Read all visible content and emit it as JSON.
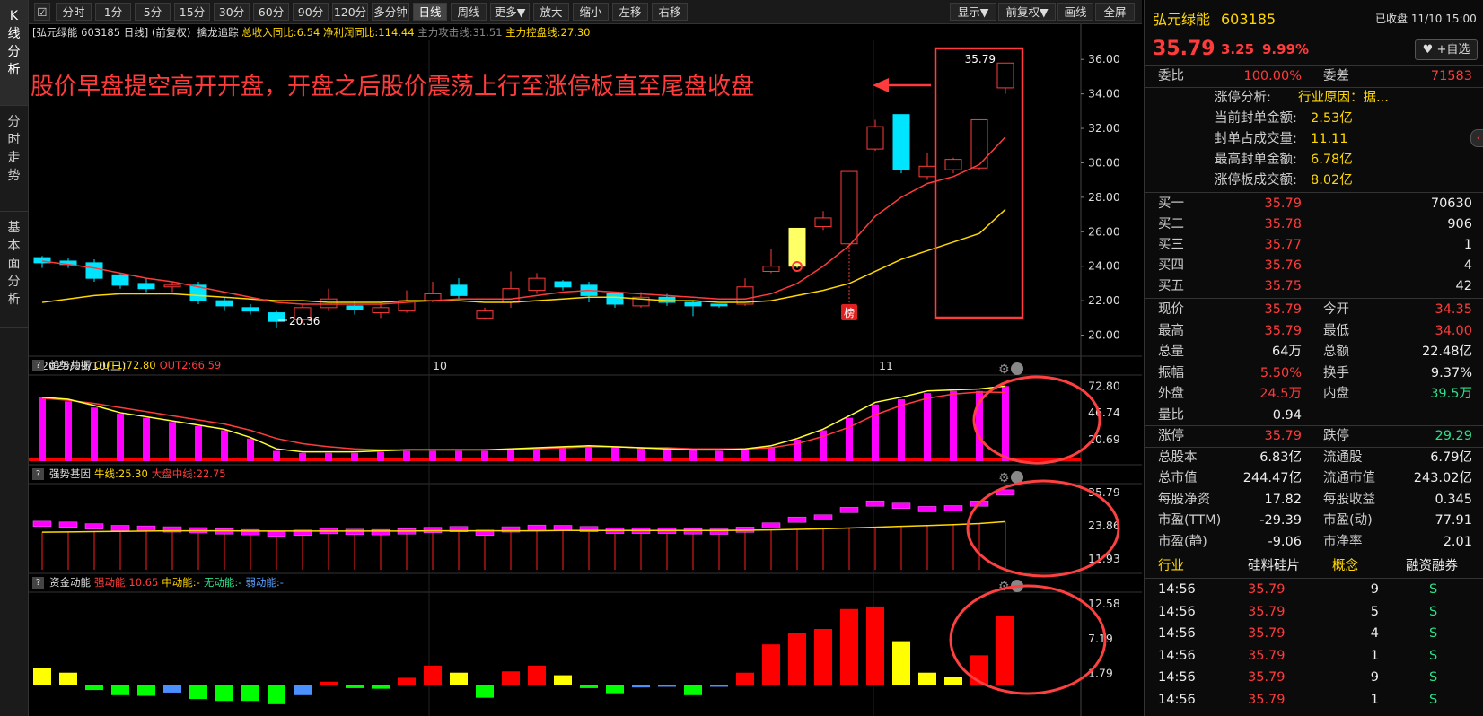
{
  "left_tabs": [
    "K线分析",
    "分时走势",
    "基本面分析"
  ],
  "toolbar": {
    "left": [
      "分时",
      "1分",
      "5分",
      "15分",
      "30分",
      "60分",
      "90分",
      "120分",
      "多分钟",
      "日线",
      "周线",
      "更多▼",
      "放大",
      "缩小",
      "左移",
      "右移"
    ],
    "active": "日线",
    "right": [
      "显示▼",
      "前复权▼",
      "画线",
      "全屏"
    ]
  },
  "main_header": {
    "name": "[弘元绿能 603185 日线]",
    "adj": "(前复权)",
    "indicator": "擒龙追踪",
    "item1": "总收入同比:6.54",
    "item2": "净利润同比:114.44",
    "item3": "主力攻击线:31.51",
    "item4": "主力控盘线:27.30"
  },
  "annotation_text": "股价早盘提空高开开盘，开盘之后股价震荡上行至涨停板直至尾盘收盘",
  "price_axis": [
    "36.00",
    "34.00",
    "32.00",
    "30.00",
    "28.00",
    "26.00",
    "24.00",
    "22.00",
    "20.00"
  ],
  "low_marker": "20.36",
  "high_marker": "35.79",
  "bang_label": "榜",
  "date_axis": {
    "start": "2025/09/10(三)",
    "m10": "10",
    "m11": "11"
  },
  "panels": {
    "trend": {
      "name": "趋势共振",
      "out1": "OUT1:72.80",
      "out2": "OUT2:66.59",
      "axis": [
        "72.80",
        "46.74",
        "20.69"
      ]
    },
    "strong": {
      "name": "强势基因",
      "bull": "牛线:25.30",
      "mid": "大盘中线:22.75",
      "axis": [
        "35.79",
        "23.86",
        "11.93"
      ]
    },
    "fund": {
      "name": "资金动能",
      "strong": "强动能:10.65",
      "mid": "中动能:-",
      "none": "无动能:-",
      "weak": "弱动能:-",
      "axis": [
        "12.58",
        "7.19",
        "1.79"
      ]
    }
  },
  "chart_data": {
    "type": "candlestick",
    "candles": [
      [
        24.5,
        24.2,
        24.6,
        23.9
      ],
      [
        24.3,
        24.1,
        24.5,
        23.9
      ],
      [
        24.2,
        23.3,
        24.4,
        23.1
      ],
      [
        23.5,
        22.9,
        23.6,
        22.7
      ],
      [
        23.0,
        22.7,
        23.3,
        22.5
      ],
      [
        22.8,
        22.9,
        23.1,
        22.5
      ],
      [
        22.9,
        22.0,
        23.1,
        21.8
      ],
      [
        22.0,
        21.7,
        22.2,
        21.4
      ],
      [
        21.6,
        21.4,
        21.8,
        21.2
      ],
      [
        21.3,
        20.8,
        21.4,
        20.4
      ],
      [
        20.9,
        21.6,
        21.8,
        20.7
      ],
      [
        21.6,
        22.1,
        22.7,
        21.4
      ],
      [
        21.7,
        21.5,
        22.0,
        21.2
      ],
      [
        21.3,
        21.6,
        21.9,
        21.0
      ],
      [
        21.4,
        22.0,
        22.6,
        21.3
      ],
      [
        22.0,
        22.4,
        23.1,
        21.9
      ],
      [
        22.9,
        22.3,
        23.3,
        22.1
      ],
      [
        21.0,
        21.4,
        21.6,
        20.9
      ],
      [
        21.9,
        22.7,
        23.7,
        21.6
      ],
      [
        22.6,
        23.3,
        23.6,
        22.4
      ],
      [
        23.1,
        22.8,
        23.2,
        22.6
      ],
      [
        22.9,
        22.3,
        23.1,
        21.9
      ],
      [
        22.4,
        21.8,
        22.5,
        21.6
      ],
      [
        21.7,
        22.2,
        22.5,
        21.6
      ],
      [
        22.2,
        21.9,
        22.4,
        21.7
      ],
      [
        21.9,
        21.7,
        22.0,
        21.1
      ],
      [
        21.8,
        21.7,
        21.8,
        21.6
      ],
      [
        21.8,
        22.8,
        23.3,
        21.7
      ],
      [
        23.7,
        24.0,
        25.0,
        23.6
      ],
      [
        24.0,
        26.2,
        26.2,
        23.9
      ],
      [
        26.3,
        26.8,
        27.2,
        26.1
      ],
      [
        25.3,
        29.5,
        29.5,
        21.2
      ],
      [
        30.8,
        32.1,
        32.5,
        30.7
      ],
      [
        32.8,
        29.6,
        32.8,
        29.4
      ],
      [
        29.2,
        29.8,
        30.6,
        29.0
      ],
      [
        29.6,
        30.2,
        30.3,
        29.4
      ],
      [
        29.7,
        32.5,
        32.5,
        29.6
      ],
      [
        34.35,
        35.79,
        35.79,
        34.0
      ]
    ],
    "ma_short": [
      24.3,
      24.1,
      23.9,
      23.6,
      23.3,
      23.1,
      22.8,
      22.5,
      22.2,
      21.9,
      21.8,
      21.8,
      21.8,
      21.8,
      21.9,
      22.0,
      22.1,
      22.1,
      22.1,
      22.3,
      22.5,
      22.6,
      22.5,
      22.4,
      22.3,
      22.2,
      22.1,
      22.1,
      22.4,
      23.0,
      24.0,
      25.2,
      26.9,
      28.0,
      28.8,
      29.2,
      29.9,
      31.5
    ],
    "ma_long": [
      21.9,
      22.1,
      22.3,
      22.4,
      22.4,
      22.4,
      22.3,
      22.2,
      22.1,
      22.0,
      22.0,
      21.9,
      21.9,
      21.9,
      22.0,
      22.0,
      22.0,
      21.9,
      21.9,
      22.0,
      22.1,
      22.2,
      22.2,
      22.1,
      22.0,
      22.0,
      21.9,
      21.9,
      22.0,
      22.3,
      22.6,
      23.0,
      23.7,
      24.4,
      24.9,
      25.4,
      25.9,
      27.3
    ],
    "trend_bars": [
      62,
      58,
      52,
      46,
      42,
      38,
      34,
      30,
      22,
      10,
      8,
      8,
      8,
      9,
      10,
      10,
      10,
      10,
      11,
      12,
      13,
      15,
      14,
      13,
      12,
      11,
      10,
      11,
      14,
      21,
      30,
      42,
      55,
      60,
      66,
      68,
      68,
      72.8
    ],
    "trend_out1": [
      62,
      60,
      54,
      47,
      43,
      39,
      35,
      31,
      23,
      12,
      9,
      9,
      9,
      10,
      11,
      11,
      11,
      11,
      12,
      13,
      14,
      15,
      14,
      13,
      12,
      11,
      11,
      12,
      15,
      22,
      31,
      44,
      57,
      62,
      68,
      69,
      70,
      72.8
    ],
    "trend_out2": [
      61,
      59,
      56,
      52,
      48,
      44,
      40,
      36,
      30,
      22,
      17,
      14,
      12,
      11,
      11,
      11,
      11,
      11,
      11,
      12,
      13,
      14,
      14,
      13,
      13,
      12,
      12,
      12,
      13,
      17,
      24,
      33,
      45,
      54,
      61,
      65,
      67,
      66.59
    ],
    "strong_bars": [
      24.5,
      24.2,
      23.6,
      23.0,
      22.8,
      22.5,
      22.2,
      21.8,
      21.5,
      21.0,
      21.3,
      21.9,
      21.6,
      21.5,
      21.8,
      22.3,
      22.6,
      21.3,
      22.5,
      23.1,
      23.0,
      22.6,
      22.0,
      22.0,
      22.0,
      21.8,
      21.7,
      22.4,
      23.9,
      26.0,
      26.8,
      29.5,
      31.8,
      31.0,
      29.8,
      30.1,
      31.8,
      35.79
    ],
    "strong_bull": [
      21.5,
      21.6,
      21.7,
      21.8,
      21.9,
      22.0,
      22.0,
      22.0,
      21.9,
      21.9,
      21.9,
      21.9,
      21.9,
      21.9,
      21.9,
      22.0,
      22.0,
      22.0,
      22.0,
      22.0,
      22.1,
      22.1,
      22.1,
      22.1,
      22.1,
      22.1,
      22.1,
      22.2,
      22.3,
      22.5,
      22.7,
      23.0,
      23.3,
      23.6,
      23.9,
      24.2,
      24.6,
      25.3
    ],
    "fund_bars": [
      [
        2.6,
        "y"
      ],
      [
        1.9,
        "y"
      ],
      [
        -0.8,
        "g"
      ],
      [
        -1.6,
        "g"
      ],
      [
        -1.7,
        "g"
      ],
      [
        -1.2,
        "b"
      ],
      [
        -2.2,
        "g"
      ],
      [
        -2.5,
        "g"
      ],
      [
        -2.5,
        "g"
      ],
      [
        -3.0,
        "g"
      ],
      [
        -1.6,
        "b"
      ],
      [
        0.5,
        "r"
      ],
      [
        -0.5,
        "g"
      ],
      [
        -0.6,
        "g"
      ],
      [
        1.1,
        "r"
      ],
      [
        3.0,
        "r"
      ],
      [
        1.9,
        "y"
      ],
      [
        -2.0,
        "g"
      ],
      [
        2.1,
        "r"
      ],
      [
        3.0,
        "r"
      ],
      [
        1.5,
        "y"
      ],
      [
        -0.5,
        "g"
      ],
      [
        -1.3,
        "g"
      ],
      [
        -0.4,
        "b"
      ],
      [
        -0.3,
        "b"
      ],
      [
        -1.6,
        "g"
      ],
      [
        -0.3,
        "b"
      ],
      [
        1.9,
        "r"
      ],
      [
        6.3,
        "r"
      ],
      [
        8.0,
        "r"
      ],
      [
        8.7,
        "r"
      ],
      [
        11.8,
        "r"
      ],
      [
        12.2,
        "r"
      ],
      [
        6.8,
        "y"
      ],
      [
        1.9,
        "y"
      ],
      [
        1.3,
        "y"
      ],
      [
        4.6,
        "r"
      ],
      [
        10.65,
        "r"
      ]
    ]
  },
  "quote": {
    "name": "弘元绿能",
    "code": "603185",
    "status": "已收盘 11/10 15:00",
    "price": "35.79",
    "change": "3.25",
    "pct": "9.99%",
    "watch": "+自选",
    "weibi_lbl": "委比",
    "weibi": "100.00%",
    "weicha_lbl": "委差",
    "weicha": "71583",
    "limit_analysis": "涨停分析:",
    "limit_reason": "行业原因：据...",
    "seal_amount_lbl": "当前封单金额:",
    "seal_amount": "2.53亿",
    "seal_ratio_lbl": "封单占成交量:",
    "seal_ratio": "11.11",
    "max_seal_lbl": "最高封单金额:",
    "max_seal": "6.78亿",
    "limit_turnover_lbl": "涨停板成交额:",
    "limit_turnover": "8.02亿",
    "bids": [
      {
        "lbl": "买一",
        "price": "35.79",
        "vol": "70630"
      },
      {
        "lbl": "买二",
        "price": "35.78",
        "vol": "906"
      },
      {
        "lbl": "买三",
        "price": "35.77",
        "vol": "1"
      },
      {
        "lbl": "买四",
        "price": "35.76",
        "vol": "4"
      },
      {
        "lbl": "买五",
        "price": "35.75",
        "vol": "42"
      }
    ],
    "stats": [
      [
        {
          "l": "现价",
          "v": "35.79",
          "c": "red"
        },
        {
          "l": "今开",
          "v": "34.35",
          "c": "red"
        }
      ],
      [
        {
          "l": "最高",
          "v": "35.79",
          "c": "red"
        },
        {
          "l": "最低",
          "v": "34.00",
          "c": "red"
        }
      ],
      [
        {
          "l": "总量",
          "v": "64万",
          "c": "white"
        },
        {
          "l": "总额",
          "v": "22.48亿",
          "c": "white"
        }
      ],
      [
        {
          "l": "振幅",
          "v": "5.50%",
          "c": "red"
        },
        {
          "l": "换手",
          "v": "9.37%",
          "c": "white"
        }
      ],
      [
        {
          "l": "外盘",
          "v": "24.5万",
          "c": "red"
        },
        {
          "l": "内盘",
          "v": "39.5万",
          "c": "green"
        }
      ],
      [
        {
          "l": "量比",
          "v": "0.94",
          "c": "white"
        },
        {
          "l": "",
          "v": "",
          "c": "white"
        }
      ],
      [
        {
          "l": "涨停",
          "v": "35.79",
          "c": "red"
        },
        {
          "l": "跌停",
          "v": "29.29",
          "c": "green"
        }
      ],
      [
        {
          "l": "总股本",
          "v": "6.83亿",
          "c": "white"
        },
        {
          "l": "流通股",
          "v": "6.79亿",
          "c": "white"
        }
      ],
      [
        {
          "l": "总市值",
          "v": "244.47亿",
          "c": "white"
        },
        {
          "l": "流通市值",
          "v": "243.02亿",
          "c": "white"
        }
      ],
      [
        {
          "l": "每股净资",
          "v": "17.82",
          "c": "white"
        },
        {
          "l": "每股收益",
          "v": "0.345",
          "c": "white"
        }
      ],
      [
        {
          "l": "市盈(TTM)",
          "v": "-29.39",
          "c": "white"
        },
        {
          "l": "市盈(动)",
          "v": "77.91",
          "c": "white"
        }
      ],
      [
        {
          "l": "市盈(静)",
          "v": "-9.06",
          "c": "white"
        },
        {
          "l": "市净率",
          "v": "2.01",
          "c": "white"
        }
      ]
    ],
    "tags": {
      "industry_lbl": "行业",
      "industry": "硅料硅片",
      "concept": "概念",
      "margin": "融资融券"
    },
    "ticks": [
      {
        "t": "14:56",
        "p": "35.79",
        "v": "9",
        "d": "S"
      },
      {
        "t": "14:56",
        "p": "35.79",
        "v": "5",
        "d": "S"
      },
      {
        "t": "14:56",
        "p": "35.79",
        "v": "4",
        "d": "S"
      },
      {
        "t": "14:56",
        "p": "35.79",
        "v": "1",
        "d": "S"
      },
      {
        "t": "14:56",
        "p": "35.79",
        "v": "9",
        "d": "S"
      },
      {
        "t": "14:56",
        "p": "35.79",
        "v": "1",
        "d": "S"
      }
    ]
  }
}
